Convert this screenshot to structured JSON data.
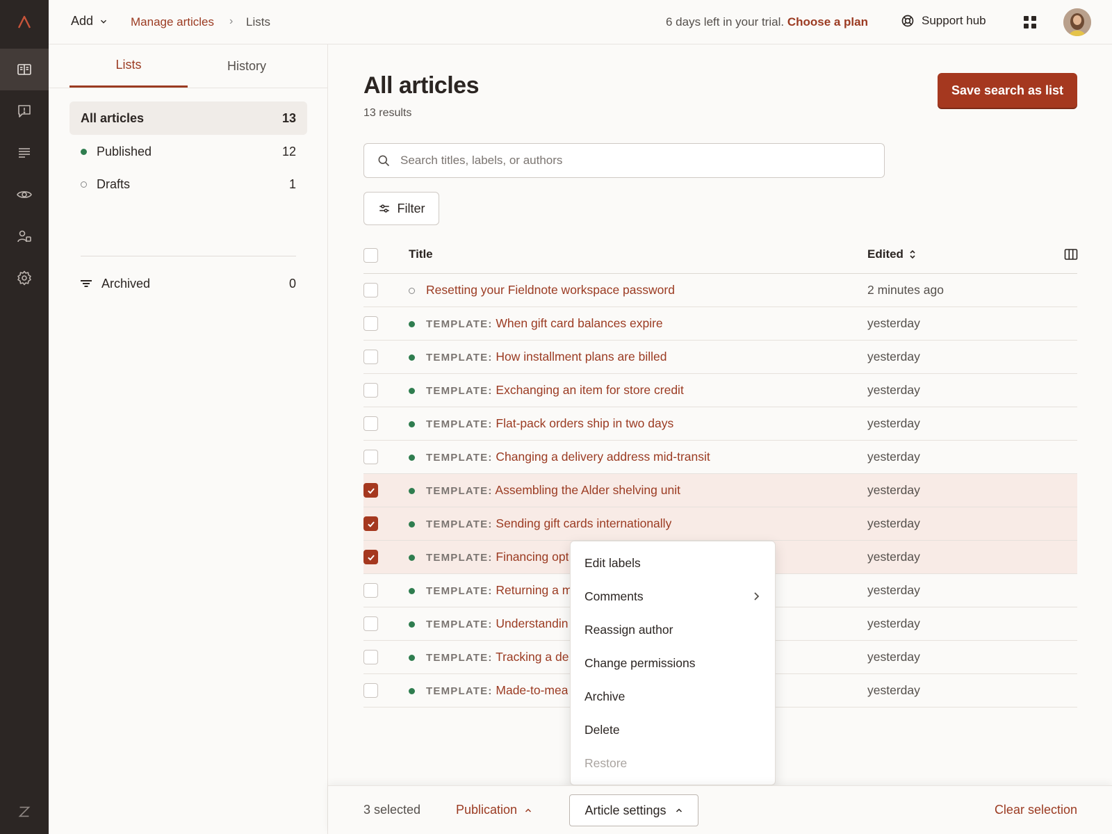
{
  "topbar": {
    "add_label": "Add",
    "breadcrumb_link": "Manage articles",
    "breadcrumb_sep": "›",
    "breadcrumb_current": "Lists",
    "trial_text": "6 days left in your trial.",
    "trial_link": "Choose a plan",
    "support_label": "Support hub"
  },
  "sidebar": {
    "tabs": [
      {
        "label": "Lists",
        "active": true
      },
      {
        "label": "History",
        "active": false
      }
    ],
    "items": [
      {
        "label": "All articles",
        "count": "13",
        "active": true
      },
      {
        "label": "Published",
        "count": "12",
        "status": "published"
      },
      {
        "label": "Drafts",
        "count": "1",
        "status": "draft"
      },
      {
        "label": "Archived",
        "count": "0",
        "status": "archived"
      }
    ]
  },
  "main": {
    "title": "All articles",
    "results": "13 results",
    "save_button": "Save search as list",
    "search_placeholder": "Search titles, labels, or authors",
    "filter_label": "Filter",
    "columns": {
      "title": "Title",
      "edited": "Edited"
    }
  },
  "rows": [
    {
      "prefix": "",
      "title": "Resetting your Fieldnote workspace password",
      "edited": "2 minutes ago",
      "status": "draft",
      "checked": false
    },
    {
      "prefix": "TEMPLATE:",
      "title": "When gift card balances expire",
      "edited": "yesterday",
      "status": "published",
      "checked": false
    },
    {
      "prefix": "TEMPLATE:",
      "title": "How installment plans are billed",
      "edited": "yesterday",
      "status": "published",
      "checked": false
    },
    {
      "prefix": "TEMPLATE:",
      "title": "Exchanging an item for store credit",
      "edited": "yesterday",
      "status": "published",
      "checked": false
    },
    {
      "prefix": "TEMPLATE:",
      "title": "Flat-pack orders ship in two days",
      "edited": "yesterday",
      "status": "published",
      "checked": false
    },
    {
      "prefix": "TEMPLATE:",
      "title": "Changing a delivery address mid-transit",
      "edited": "yesterday",
      "status": "published",
      "checked": false
    },
    {
      "prefix": "TEMPLATE:",
      "title": "Assembling the Alder shelving unit",
      "edited": "yesterday",
      "status": "published",
      "checked": true
    },
    {
      "prefix": "TEMPLATE:",
      "title": "Sending gift cards internationally",
      "edited": "yesterday",
      "status": "published",
      "checked": true
    },
    {
      "prefix": "TEMPLATE:",
      "title": "Financing opt",
      "edited": "yesterday",
      "status": "published",
      "checked": true
    },
    {
      "prefix": "TEMPLATE:",
      "title": "Returning a m",
      "edited": "yesterday",
      "status": "published",
      "checked": false
    },
    {
      "prefix": "TEMPLATE:",
      "title": "Understandin",
      "edited": "yesterday",
      "status": "published",
      "checked": false
    },
    {
      "prefix": "TEMPLATE:",
      "title": "Tracking a de",
      "edited": "yesterday",
      "status": "published",
      "checked": false
    },
    {
      "prefix": "TEMPLATE:",
      "title": "Made-to-mea",
      "edited": "yesterday",
      "status": "published",
      "checked": false
    }
  ],
  "menu": {
    "items": [
      {
        "label": "Edit labels",
        "disabled": false,
        "submenu": false
      },
      {
        "label": "Comments",
        "disabled": false,
        "submenu": true
      },
      {
        "label": "Reassign author",
        "disabled": false,
        "submenu": false
      },
      {
        "label": "Change permissions",
        "disabled": false,
        "submenu": false
      },
      {
        "label": "Archive",
        "disabled": false,
        "submenu": false
      },
      {
        "label": "Delete",
        "disabled": false,
        "submenu": false
      },
      {
        "label": "Restore",
        "disabled": true,
        "submenu": false
      }
    ]
  },
  "bottombar": {
    "selected": "3 selected",
    "publication": "Publication",
    "article_settings": "Article settings",
    "clear": "Clear selection"
  },
  "colors": {
    "accent": "#9b3b22",
    "primary_button": "#a5381f",
    "rail": "#2c2624",
    "published": "#2f7d4f",
    "selected_row": "#f8ebe6"
  },
  "icons": {
    "rail": [
      "articles-icon",
      "feedback-icon",
      "list-icon",
      "eye-icon",
      "users-icon",
      "settings-icon"
    ],
    "brand": "logo-icon",
    "rail_bottom": "zendesk-z-icon"
  }
}
